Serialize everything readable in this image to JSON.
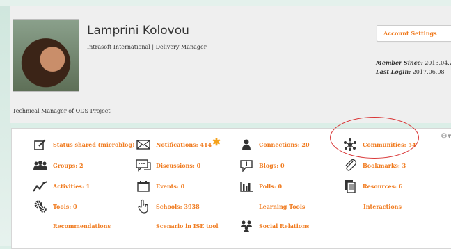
{
  "profile": {
    "name": "Lamprini Kolovou",
    "org": "Intrasoft International | Delivery Manager",
    "account_settings": "Account Settings",
    "member_since_label": "Member Since:",
    "member_since_value": "2013.04.2",
    "last_login_label": "Last Login:",
    "last_login_value": "2017.06.08",
    "description": "Technical Manager of ODS Project"
  },
  "stats": {
    "status": "Status shared (microblog)",
    "notifications": "Notifications: 414",
    "connections": "Connections: 20",
    "communities": "Communities: 54",
    "groups": "Groups: 2",
    "discussions": "Discussions: 0",
    "blogs": "Blogs: 0",
    "bookmarks": "Bookmarks: 3",
    "activities": "Activities: 1",
    "events": "Events: 0",
    "polls": "Polls: 0",
    "resources": "Resources: 6",
    "tools": "Tools: 0",
    "schools": "Schools: 3938",
    "learning_tools": "Learning Tools",
    "interactions": "Interactions",
    "recommendations": "Recommendations",
    "scenario": "Scenario in ISE tool",
    "social_relations": "Social Relations"
  },
  "colors": {
    "accent": "#f07b1f",
    "highlight": "#d93636",
    "star": "#f5a11a"
  },
  "icons": [
    "edit-icon",
    "envelope-icon",
    "person-icon",
    "network-icon",
    "groups-icon",
    "chat-icon",
    "blog-icon",
    "paperclip-icon",
    "trend-icon",
    "calendar-icon",
    "bars-icon",
    "documents-icon",
    "gears-icon",
    "pointer-hand-icon",
    "social-icon",
    "gear-menu-icon"
  ]
}
